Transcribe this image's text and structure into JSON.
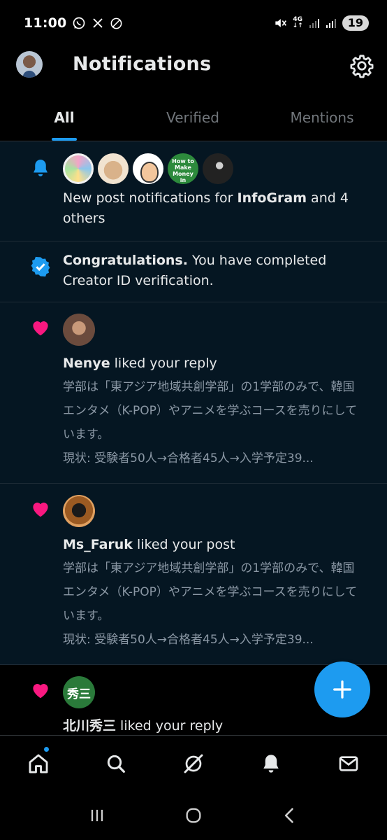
{
  "status_bar": {
    "time": "11:00",
    "network": "4G",
    "battery": "19",
    "icons": [
      "whatsapp-icon",
      "x-icon",
      "do-not-disturb-icon",
      "mute-icon",
      "signal-icon",
      "signal-icon"
    ]
  },
  "header": {
    "title": "Notifications",
    "settings_icon": "gear-icon"
  },
  "tabs": [
    {
      "label": "All",
      "active": true
    },
    {
      "label": "Verified",
      "active": false
    },
    {
      "label": "Mentions",
      "active": false
    }
  ],
  "notifications": [
    {
      "type": "new_post",
      "icon": "bell-icon",
      "text_pre": "New post notifications for ",
      "bold": "InfoGram",
      "text_post": " and 4 others",
      "avatar_money_text": "How to Make Money in Stocks"
    },
    {
      "type": "verification",
      "icon": "verified-badge-icon",
      "bold": "Congratulations.",
      "text_post": "  You have completed Creator ID verification."
    },
    {
      "type": "like",
      "icon": "heart-icon",
      "user": "Nenye",
      "action": " liked your reply",
      "snippet_1": "学部は「東アジア地域共創学部」の1学部のみで、韓国エンタメ（K-POP）やアニメを学ぶコースを売りにしています。",
      "snippet_2": "現状: 受験者50人→合格者45人→入学予定39..."
    },
    {
      "type": "like",
      "icon": "heart-icon",
      "user": "Ms_Faruk",
      "action": " liked your post",
      "snippet_1": "学部は「東アジア地域共創学部」の1学部のみで、韓国エンタメ（K-POP）やアニメを学ぶコースを売りにしています。",
      "snippet_2": "現状: 受験者50人→合格者45人→入学予定39..."
    },
    {
      "type": "like",
      "icon": "heart-icon",
      "user": "北川秀三",
      "avatar_text": "秀三",
      "action": " liked your reply"
    }
  ],
  "bottom_nav": [
    "home-icon",
    "search-icon",
    "grok-icon",
    "notifications-icon",
    "messages-icon"
  ],
  "colors": {
    "accent": "#1d9bf0",
    "like": "#f91880",
    "background": "#000000",
    "unread_bg": "#051622"
  }
}
